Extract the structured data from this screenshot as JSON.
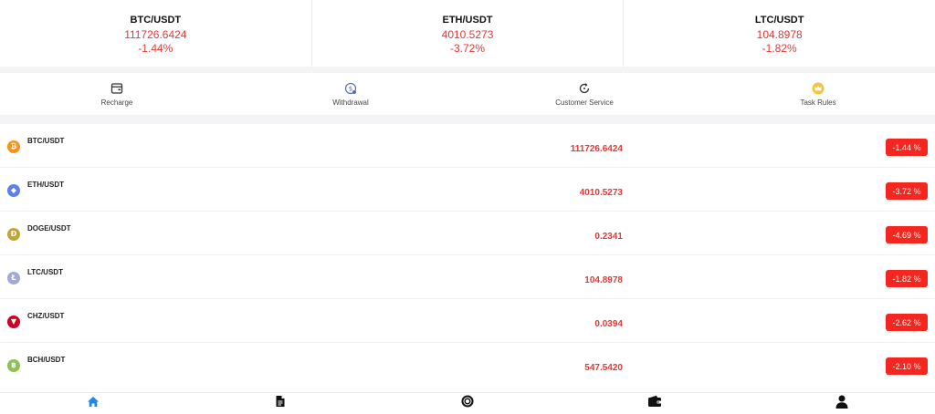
{
  "ticker": [
    {
      "pair": "BTC/USDT",
      "price": "111726.6424",
      "change": "-1.44%"
    },
    {
      "pair": "ETH/USDT",
      "price": "4010.5273",
      "change": "-3.72%"
    },
    {
      "pair": "LTC/USDT",
      "price": "104.8978",
      "change": "-1.82%"
    }
  ],
  "menu": [
    {
      "label": "Recharge",
      "icon": "wallet-card-icon"
    },
    {
      "label": "Withdrawal",
      "icon": "withdraw-coin-icon"
    },
    {
      "label": "Customer Service",
      "icon": "refresh-support-icon"
    },
    {
      "label": "Task Rules",
      "icon": "crown-icon"
    }
  ],
  "market": [
    {
      "pair": "BTC/USDT",
      "price": "111726.6424",
      "change": "-1.44 %",
      "color": "#f7931a",
      "symbol": "₿"
    },
    {
      "pair": "ETH/USDT",
      "price": "4010.5273",
      "change": "-3.72 %",
      "color": "#627eea",
      "symbol": "◆"
    },
    {
      "pair": "DOGE/USDT",
      "price": "0.2341",
      "change": "-4.69 %",
      "color": "#c2a633",
      "symbol": "Ð"
    },
    {
      "pair": "LTC/USDT",
      "price": "104.8978",
      "change": "-1.82 %",
      "color": "#a6a9d6",
      "symbol": "Ł"
    },
    {
      "pair": "CHZ/USDT",
      "price": "0.0394",
      "change": "-2.62 %",
      "color": "#cd0124",
      "symbol": "▼"
    },
    {
      "pair": "BCH/USDT",
      "price": "547.5420",
      "change": "-2.10 %",
      "color": "#8dc351",
      "symbol": "฿"
    }
  ],
  "bottom_nav": [
    {
      "name": "home-icon",
      "active": true
    },
    {
      "name": "document-icon",
      "active": false
    },
    {
      "name": "trade-circle-icon",
      "active": false
    },
    {
      "name": "wallet-icon",
      "active": false
    },
    {
      "name": "user-icon",
      "active": false
    }
  ],
  "colors": {
    "negative": "#e53935",
    "badge": "#f5251f",
    "active_nav": "#1e88e5",
    "nav": "#111111"
  }
}
